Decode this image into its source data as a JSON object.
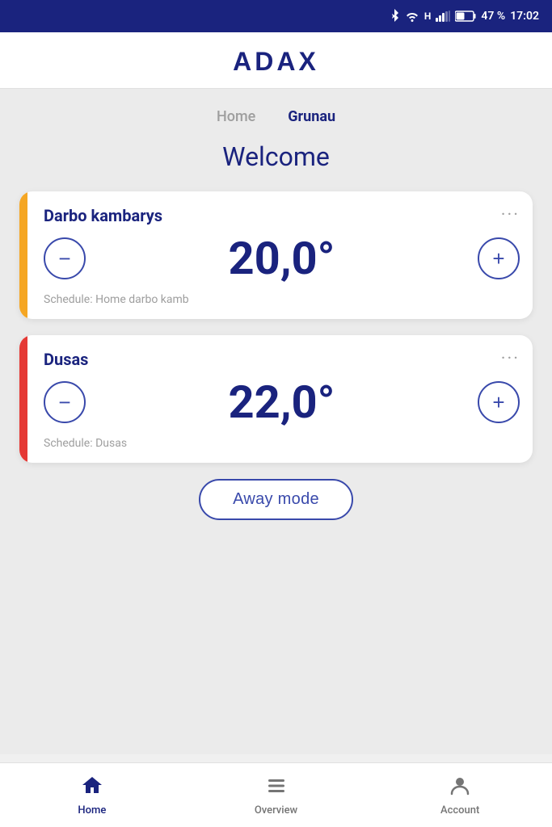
{
  "statusBar": {
    "battery": "47 %",
    "time": "17:02"
  },
  "header": {
    "logo": "ADAX"
  },
  "locationTabs": [
    {
      "label": "Home",
      "active": false
    },
    {
      "label": "Grunau",
      "active": true
    }
  ],
  "welcome": "Welcome",
  "devices": [
    {
      "id": "darbo-kambarys",
      "name": "Darbo kambarys",
      "temperature": "20,0°",
      "schedule": "Schedule: Home darbo kamb",
      "accentColor": "yellow"
    },
    {
      "id": "dusas",
      "name": "Dusas",
      "temperature": "22,0°",
      "schedule": "Schedule: Dusas",
      "accentColor": "orange"
    }
  ],
  "awayButton": "Away mode",
  "nav": {
    "items": [
      {
        "label": "Home",
        "icon": "home",
        "active": true
      },
      {
        "label": "Overview",
        "icon": "list",
        "active": false
      },
      {
        "label": "Account",
        "icon": "account",
        "active": false
      }
    ]
  }
}
